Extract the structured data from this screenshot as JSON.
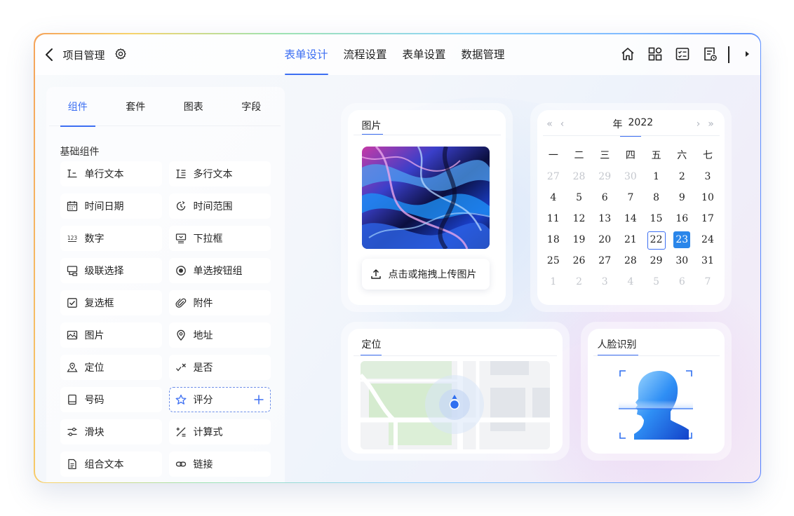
{
  "header": {
    "title": "项目管理",
    "tabs": [
      {
        "label": "表单设计",
        "active": true
      },
      {
        "label": "流程设置",
        "active": false
      },
      {
        "label": "表单设置",
        "active": false
      },
      {
        "label": "数据管理",
        "active": false
      }
    ],
    "icons": [
      "home-icon",
      "apps-grid-icon",
      "list-check-icon",
      "document-clock-icon",
      "play-right-icon"
    ]
  },
  "left_panel": {
    "tabs": [
      {
        "label": "组件",
        "active": true
      },
      {
        "label": "套件",
        "active": false
      },
      {
        "label": "图表",
        "active": false
      },
      {
        "label": "字段",
        "active": false
      }
    ],
    "section_title": "基础组件",
    "components": [
      {
        "label": "单行文本",
        "icon": "single-line-text-icon"
      },
      {
        "label": "多行文本",
        "icon": "multi-line-text-icon"
      },
      {
        "label": "时间日期",
        "icon": "calendar-icon"
      },
      {
        "label": "时间范围",
        "icon": "time-range-icon"
      },
      {
        "label": "数字",
        "icon": "number-icon",
        "glyph": "123"
      },
      {
        "label": "下拉框",
        "icon": "dropdown-icon"
      },
      {
        "label": "级联选择",
        "icon": "cascade-icon"
      },
      {
        "label": "单选按钮组",
        "icon": "radio-icon"
      },
      {
        "label": "复选框",
        "icon": "checkbox-icon"
      },
      {
        "label": "附件",
        "icon": "paperclip-icon"
      },
      {
        "label": "图片",
        "icon": "image-icon"
      },
      {
        "label": "地址",
        "icon": "location-pin-icon"
      },
      {
        "label": "定位",
        "icon": "position-icon"
      },
      {
        "label": "是否",
        "icon": "yes-no-icon"
      },
      {
        "label": "号码",
        "icon": "phone-number-icon"
      },
      {
        "label": "评分",
        "icon": "star-icon",
        "dragging": true
      },
      {
        "label": "滑块",
        "icon": "slider-icon"
      },
      {
        "label": "计算式",
        "icon": "formula-icon"
      },
      {
        "label": "组合文本",
        "icon": "combined-text-icon"
      },
      {
        "label": "链接",
        "icon": "link-icon"
      }
    ]
  },
  "image_card": {
    "title": "图片",
    "upload_label": "点击或拖拽上传图片"
  },
  "calendar": {
    "year_label": "年",
    "year": "2022",
    "weekdays": [
      "一",
      "二",
      "三",
      "四",
      "五",
      "六",
      "七"
    ],
    "weeks": [
      [
        {
          "d": "27",
          "m": true
        },
        {
          "d": "28",
          "m": true
        },
        {
          "d": "29",
          "m": true
        },
        {
          "d": "30",
          "m": true
        },
        {
          "d": "1"
        },
        {
          "d": "2"
        },
        {
          "d": "3"
        }
      ],
      [
        {
          "d": "4"
        },
        {
          "d": "5"
        },
        {
          "d": "6"
        },
        {
          "d": "7"
        },
        {
          "d": "8"
        },
        {
          "d": "9"
        },
        {
          "d": "10"
        }
      ],
      [
        {
          "d": "11"
        },
        {
          "d": "12"
        },
        {
          "d": "13"
        },
        {
          "d": "14"
        },
        {
          "d": "15"
        },
        {
          "d": "16"
        },
        {
          "d": "17"
        }
      ],
      [
        {
          "d": "18"
        },
        {
          "d": "19"
        },
        {
          "d": "20"
        },
        {
          "d": "21"
        },
        {
          "d": "22",
          "today": true
        },
        {
          "d": "23",
          "selected": true
        },
        {
          "d": "24"
        }
      ],
      [
        {
          "d": "25"
        },
        {
          "d": "26"
        },
        {
          "d": "27"
        },
        {
          "d": "28"
        },
        {
          "d": "29"
        },
        {
          "d": "30"
        },
        {
          "d": "31"
        }
      ],
      [
        {
          "d": "1",
          "m": true
        },
        {
          "d": "2",
          "m": true
        },
        {
          "d": "3",
          "m": true
        },
        {
          "d": "4",
          "m": true
        },
        {
          "d": "5",
          "m": true
        },
        {
          "d": "6",
          "m": true
        },
        {
          "d": "7",
          "m": true
        }
      ]
    ]
  },
  "location_card": {
    "title": "定位"
  },
  "face_card": {
    "title": "人脸识别"
  },
  "colors": {
    "accent": "#3d6ff2",
    "selected_day": "#2a86ea"
  }
}
